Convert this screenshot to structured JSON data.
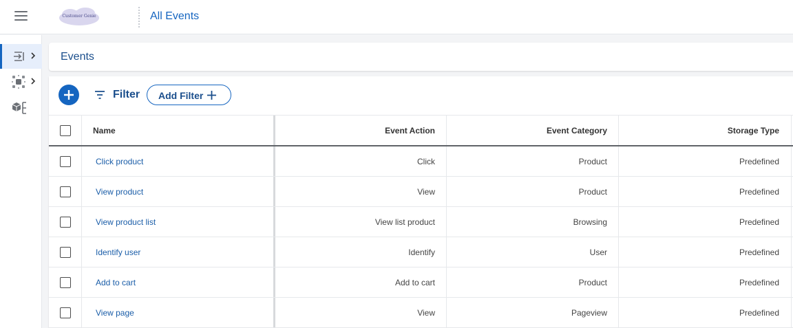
{
  "header": {
    "logo_text": "Customer Genie",
    "title": "All Events"
  },
  "rail": {
    "items": [
      {
        "icon": "import-arrow-icon",
        "active": true,
        "has_chevron": true
      },
      {
        "icon": "network-nodes-icon",
        "active": false,
        "has_chevron": true
      },
      {
        "icon": "cube-tree-icon",
        "active": false,
        "has_chevron": false
      }
    ]
  },
  "page": {
    "title": "Events"
  },
  "toolbar": {
    "filter_label": "Filter",
    "add_filter_label": "Add Filter"
  },
  "table": {
    "columns": [
      "Name",
      "Event Action",
      "Event Category",
      "Storage Type"
    ],
    "rows": [
      {
        "name": "Click product",
        "action": "Click",
        "category": "Product",
        "storage": "Predefined"
      },
      {
        "name": "View product",
        "action": "View",
        "category": "Product",
        "storage": "Predefined"
      },
      {
        "name": "View product list",
        "action": "View list product",
        "category": "Browsing",
        "storage": "Predefined"
      },
      {
        "name": "Identify user",
        "action": "Identify",
        "category": "User",
        "storage": "Predefined"
      },
      {
        "name": "Add to cart",
        "action": "Add to cart",
        "category": "Product",
        "storage": "Predefined"
      },
      {
        "name": "View page",
        "action": "View",
        "category": "Pageview",
        "storage": "Predefined"
      }
    ]
  },
  "colors": {
    "accent": "#1565c0",
    "link": "#1a5da8",
    "heading": "#1a4e8c"
  }
}
